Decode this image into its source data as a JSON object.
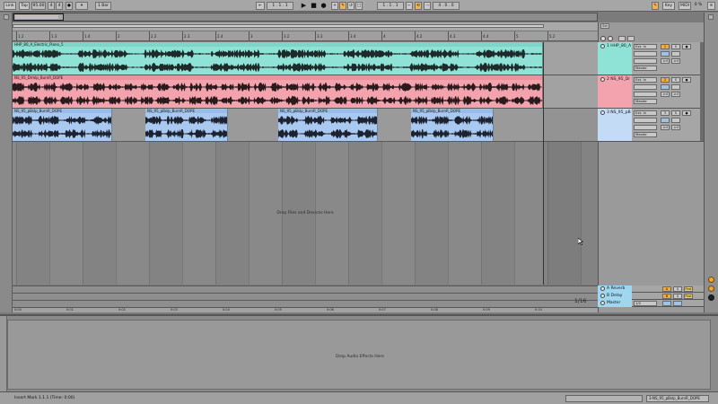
{
  "control_bar": {
    "link": "Link",
    "tap": "Tap",
    "tempo": "95.00",
    "sig_num": "4",
    "sig_den": "4",
    "metronome": "●",
    "quantize": "1 Bar",
    "arrangement_position": "1 . 1 . 1",
    "loop_start": "1 . 1 . 1",
    "loop_length": "4 . 0 . 0",
    "key": "Key",
    "midi": "MIDI",
    "cpu": "0 %"
  },
  "ruler": {
    "bars": [
      "1.2",
      "1.3",
      "1.4",
      "2",
      "2.2",
      "2.3",
      "2.4",
      "3",
      "3.2",
      "3.3",
      "3.4",
      "4",
      "4.2",
      "4.3",
      "4.4",
      "5",
      "5.2"
    ]
  },
  "time_ruler": {
    "labels": [
      "0:00",
      "0:01",
      "0:02",
      "0:03",
      "0:04",
      "0:05",
      "0:06",
      "0:07",
      "0:08",
      "0:09",
      "0:10"
    ],
    "zoom": "1/16"
  },
  "arrangement": {
    "drop_text": "Drop Files and Devices Here",
    "tracks": [
      {
        "name": "1 HHP_80_A",
        "input": "Ext. In",
        "channel": "1",
        "output": "Master",
        "color": "#8fe3d6",
        "clips": [
          {
            "title": "HHP_80_A_Electric_Piano_5"
          }
        ]
      },
      {
        "name": "2 NS_95_Dr",
        "input": "Ext. In",
        "channel": "2",
        "output": "Master",
        "color": "#f2a3ad",
        "clips": [
          {
            "title": "NS_95_Drmlp_BurnR_DOPE"
          }
        ]
      },
      {
        "name": "3 NS_95_pB",
        "input": "Ext. In",
        "channel": "3",
        "output": "Master",
        "color": "#a9c9f1",
        "clips": [
          {
            "title": "NS_95_pBslp_BurnR_DOPE"
          },
          {
            "title": "NS_95_pBslp_BurnR_DOPE"
          },
          {
            "title": "NS_95_pBslp_BurnR_DOPE"
          },
          {
            "title": "NS_95_pBslp_BurnR_DOPE"
          }
        ]
      }
    ],
    "returns": [
      {
        "name": "A Reverb",
        "letter": "A",
        "color": "#9fd7f0"
      },
      {
        "name": "B Delay",
        "letter": "B",
        "color": "#9fd7f0"
      },
      {
        "name": "Master",
        "letter": "1/2",
        "color": "#9fd7f0"
      }
    ],
    "mixer_labels": {
      "solo": "S",
      "arm": "●",
      "post": "Post",
      "inf": "-inf",
      "set": "Set"
    }
  },
  "detail": {
    "drop_text": "Drop Audio Effects Here"
  },
  "status_bar": {
    "text": "Insert Mark 1.1.1 (Time: 0:00)",
    "clip_name": "3-NS_95_pBslp_BurnR_DOPE"
  }
}
